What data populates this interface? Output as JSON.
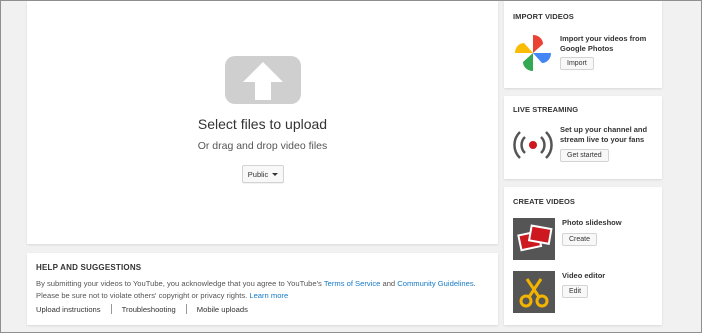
{
  "upload": {
    "title": "Select files to upload",
    "subtitle": "Or drag and drop video files",
    "privacy_value": "Public"
  },
  "help": {
    "heading": "HELP AND SUGGESTIONS",
    "text_part1": "By submitting your videos to YouTube, you acknowledge that you agree to YouTube's ",
    "terms_link": "Terms of Service",
    "and": " and ",
    "guidelines_link": "Community Guidelines",
    "text_part2": ". Please be sure not to violate others' copyright or privacy rights. ",
    "learn_more": "Learn more",
    "links": [
      "Upload instructions",
      "Troubleshooting",
      "Mobile uploads"
    ]
  },
  "import": {
    "heading": "IMPORT VIDEOS",
    "description": "Import your videos from Google Photos",
    "button": "Import"
  },
  "live": {
    "heading": "LIVE STREAMING",
    "description": "Set up your channel and stream live to your fans",
    "button": "Get started"
  },
  "create": {
    "heading": "CREATE VIDEOS",
    "slideshow_label": "Photo slideshow",
    "slideshow_button": "Create",
    "editor_label": "Video editor",
    "editor_button": "Edit"
  },
  "colors": {
    "link": "#167ac6",
    "upload_icon": "#cfcfcf",
    "live_dot": "#cc181e"
  }
}
